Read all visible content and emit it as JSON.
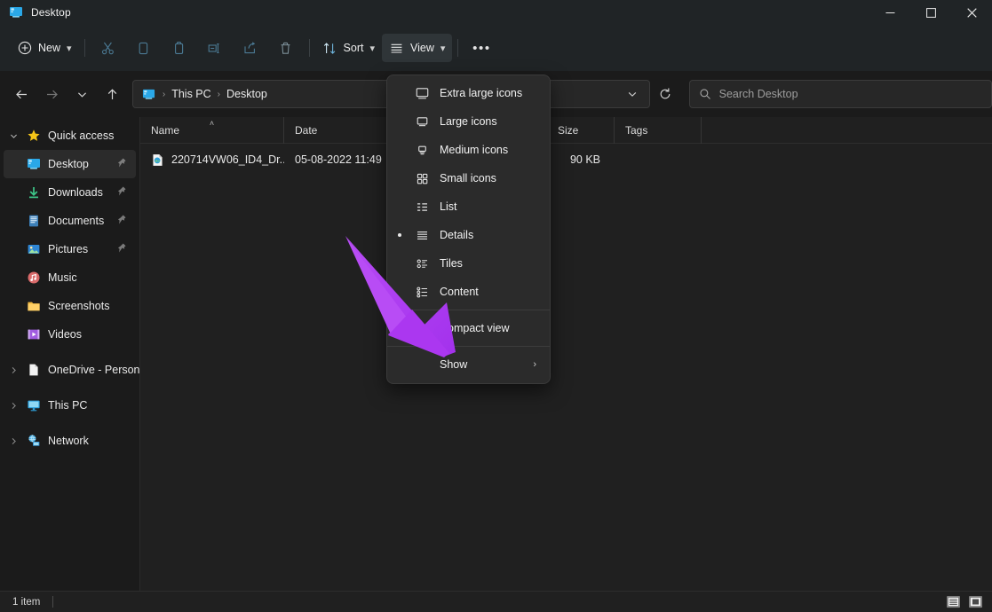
{
  "window": {
    "title": "Desktop",
    "icon": "desktop-icon",
    "controls": {
      "minimize": "—",
      "maximize": "□",
      "close": "✕"
    }
  },
  "toolbar": {
    "new_label": "New",
    "new_icon": "plus-circle-icon",
    "cut_icon": "scissors-icon",
    "copy_icon": "copy-icon",
    "paste_icon": "paste-icon",
    "rename_icon": "rename-icon",
    "share_icon": "share-icon",
    "delete_icon": "trash-icon",
    "sort_label": "Sort",
    "sort_icon": "sort-arrows-icon",
    "view_label": "View",
    "view_icon": "hamburger-icon",
    "more_label": "•••",
    "chevron": "⌄"
  },
  "address": {
    "back_icon": "arrow-left-icon",
    "forward_icon": "arrow-right-icon",
    "recent_icon": "chevron-down-icon",
    "up_icon": "arrow-up-icon",
    "path_icon": "desktop-icon",
    "crumbs": [
      "This PC",
      "Desktop"
    ],
    "separator": "›",
    "dropdown_icon": "chevron-down-icon",
    "refresh_icon": "refresh-icon"
  },
  "search": {
    "icon": "search-icon",
    "placeholder": "Search Desktop",
    "value": ""
  },
  "sidebar": {
    "groups": [
      {
        "name": "quick-access",
        "expander": "⌄",
        "icon": "star-icon",
        "label": "Quick access",
        "expanded": true,
        "items": [
          {
            "label": "Desktop",
            "icon": "desktop-icon",
            "pinned": true,
            "selected": true
          },
          {
            "label": "Downloads",
            "icon": "download-icon",
            "pinned": true,
            "selected": false
          },
          {
            "label": "Documents",
            "icon": "documents-icon",
            "pinned": true,
            "selected": false
          },
          {
            "label": "Pictures",
            "icon": "pictures-icon",
            "pinned": true,
            "selected": false
          },
          {
            "label": "Music",
            "icon": "music-icon",
            "pinned": false,
            "selected": false
          },
          {
            "label": "Screenshots",
            "icon": "folder-icon",
            "pinned": false,
            "selected": false
          },
          {
            "label": "Videos",
            "icon": "videos-icon",
            "pinned": false,
            "selected": false
          }
        ]
      }
    ],
    "roots": [
      {
        "label": "OneDrive - Personal",
        "icon": "onedrive-icon",
        "expander": "›"
      },
      {
        "label": "This PC",
        "icon": "pc-icon",
        "expander": "›"
      },
      {
        "label": "Network",
        "icon": "network-icon",
        "expander": "›"
      }
    ]
  },
  "filelist": {
    "columns": [
      {
        "key": "name",
        "label": "Name",
        "sorted": true,
        "sort_caret": "˄"
      },
      {
        "key": "date",
        "label": "Date",
        "sorted": false,
        "sort_caret": ""
      },
      {
        "key": "size",
        "label": "Size",
        "sorted": false,
        "sort_caret": ""
      },
      {
        "key": "tags",
        "label": "Tags",
        "sorted": false,
        "sort_caret": ""
      }
    ],
    "rows": [
      {
        "name": "220714VW06_ID4_Dr...",
        "date": "05-08-2022 11:49",
        "size": "90 KB",
        "tags": "",
        "icon": "image-file-icon"
      }
    ]
  },
  "view_menu": {
    "items": [
      {
        "label": "Extra large icons",
        "icon": "monitor-xl-icon",
        "checked": false,
        "submenu": false,
        "separator_before": false
      },
      {
        "label": "Large icons",
        "icon": "monitor-lg-icon",
        "checked": false,
        "submenu": false,
        "separator_before": false
      },
      {
        "label": "Medium icons",
        "icon": "monitor-md-icon",
        "checked": false,
        "submenu": false,
        "separator_before": false
      },
      {
        "label": "Small icons",
        "icon": "grid-squares-icon",
        "checked": false,
        "submenu": false,
        "separator_before": false
      },
      {
        "label": "List",
        "icon": "list-icon",
        "checked": false,
        "submenu": false,
        "separator_before": false
      },
      {
        "label": "Details",
        "icon": "details-lines-icon",
        "checked": true,
        "submenu": false,
        "separator_before": false
      },
      {
        "label": "Tiles",
        "icon": "tiles-icon",
        "checked": false,
        "submenu": false,
        "separator_before": false
      },
      {
        "label": "Content",
        "icon": "content-icon",
        "checked": false,
        "submenu": false,
        "separator_before": false
      },
      {
        "label": "Compact view",
        "icon": "compact-view-icon",
        "checked": false,
        "submenu": false,
        "separator_before": true
      },
      {
        "label": "Show",
        "icon": "",
        "checked": false,
        "submenu": true,
        "separator_before": true,
        "submenu_arrow": "›"
      }
    ]
  },
  "statusbar": {
    "item_count": "1 item",
    "details_view_icon": "details-view-icon",
    "large_icons_view_icon": "large-icons-view-icon"
  },
  "annotation": {
    "type": "arrow",
    "color": "#b23df0",
    "color2": "#a53ceb",
    "points_to": "Show"
  }
}
